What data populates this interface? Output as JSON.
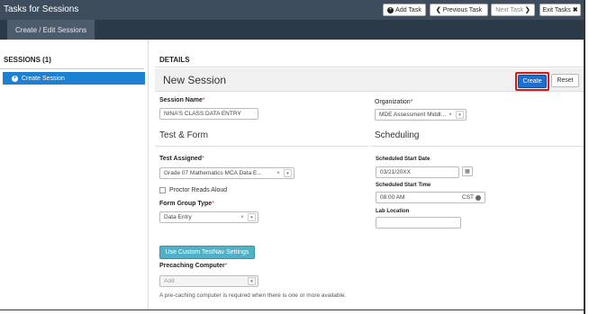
{
  "topbar": {
    "title": "Tasks for Sessions",
    "add_task": "Add Task",
    "add_task_icon": "plus-circle-icon",
    "previous_task": "Previous Task",
    "previous_icon": "chevron-left-icon",
    "next_task": "Next Task",
    "next_icon": "chevron-right-icon",
    "exit_tasks": "Exit Tasks",
    "exit_icon": "close-icon"
  },
  "subbar": {
    "tab_label": "Create / Edit Sessions"
  },
  "left_panel": {
    "heading": "SESSIONS (1)",
    "items": [
      {
        "label": "Create Session",
        "icon": "plus-circle-icon",
        "selected": true
      }
    ]
  },
  "details": {
    "heading": "DETAILS",
    "session_title": "New Session",
    "create_label": "Create",
    "reset_label": "Reset",
    "session_name_label": "Session Name",
    "session_name_value": "NINA'S CLASS DATA ENTRY",
    "organization_label": "Organization",
    "organization_value": "MDE Assessment Middl...",
    "required_mark": "*",
    "test_form_title": "Test & Form",
    "scheduling_title": "Scheduling",
    "test_assigned_label": "Test Assigned",
    "test_assigned_value": "Grade 07 Mathematics MCA Data E...",
    "proctor_reads_label": "Proctor Reads Aloud",
    "form_group_label": "Form Group Type",
    "form_group_value": "Data Entry",
    "start_date_label": "Scheduled Start Date",
    "start_date_value": "03/21/20XX",
    "start_time_label": "Scheduled Start Time",
    "start_time_value": "08:00 AM",
    "timezone": "CST",
    "lab_location_label": "Lab Location",
    "lab_location_value": "",
    "custom_btn_label": "Use Custom TestNav Settings",
    "precaching_label": "Precaching Computer",
    "precaching_placeholder": "Add",
    "help_text": "A pre-caching computer is required when there is one or more available.",
    "clear_symbol": "×",
    "arrow_symbol": "▾",
    "calendar_icon": "calendar-icon",
    "clock_icon": "clock-icon"
  },
  "colors": {
    "topbar": "#3d4d5e",
    "selected": "#1f7fd1",
    "create": "#1f6fd1",
    "highlight": "#d11a1a",
    "custom_btn": "#4fb0c6"
  }
}
